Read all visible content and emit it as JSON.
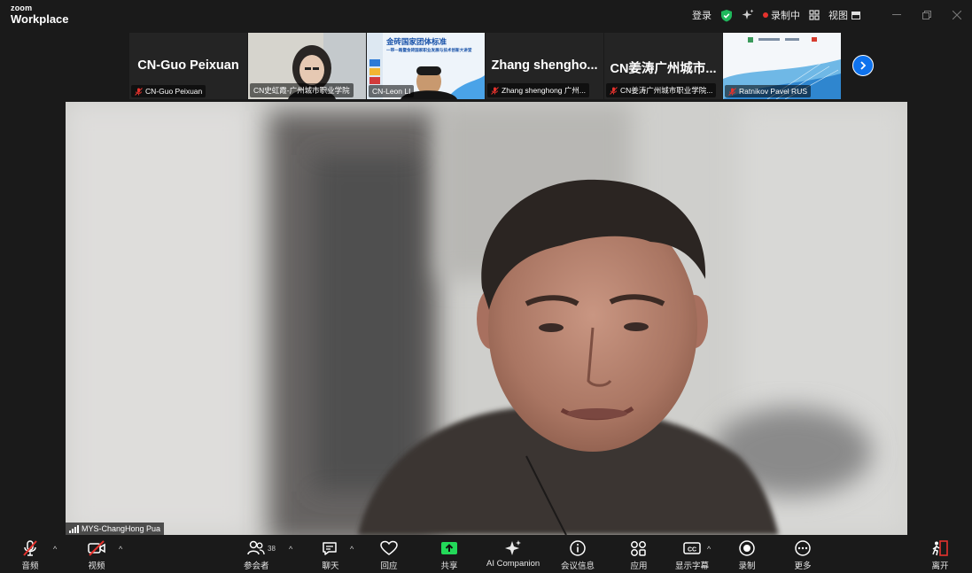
{
  "app": {
    "logo_top": "zoom",
    "logo_bottom": "Workplace"
  },
  "titlebar": {
    "login": "登录",
    "recording": "录制中",
    "view": "视图"
  },
  "strip": {
    "tiles": [
      {
        "big_name": "CN-Guo Peixuan",
        "label": "CN-Guo Peixuan",
        "muted": true
      },
      {
        "big_name": "",
        "label": "CN史虹霞-广州城市职业学院",
        "muted": false
      },
      {
        "big_name": "",
        "label": "CN-Leon LI",
        "muted": false,
        "slide_title": "金砖国家团体标准",
        "slide_sub": "一带一路暨金砖国家职业发展与技术创新大讲堂"
      },
      {
        "big_name": "Zhang shengho...",
        "label": "Zhang shenghong 广州...",
        "muted": true
      },
      {
        "big_name": "CN姜涛广州城市...",
        "label": "CN姜涛广州城市职业学院...",
        "muted": true
      },
      {
        "big_name": "",
        "label": "Ratnikov Pavel RUS",
        "muted": true
      }
    ]
  },
  "main": {
    "speaker_label": "MYS-ChangHong Pua"
  },
  "toolbar": {
    "audio": "音频",
    "video": "视频",
    "participants": "参会者",
    "participants_count": "38",
    "chat": "聊天",
    "react": "回应",
    "share": "共享",
    "ai": "AI Companion",
    "info": "会议信息",
    "apps": "应用",
    "captions": "显示字幕",
    "record": "录制",
    "more": "更多",
    "leave": "离开"
  },
  "colors": {
    "accent": "#0e72ed",
    "share": "#23d959",
    "danger": "#e5322d",
    "shield": "#1fb85c"
  }
}
